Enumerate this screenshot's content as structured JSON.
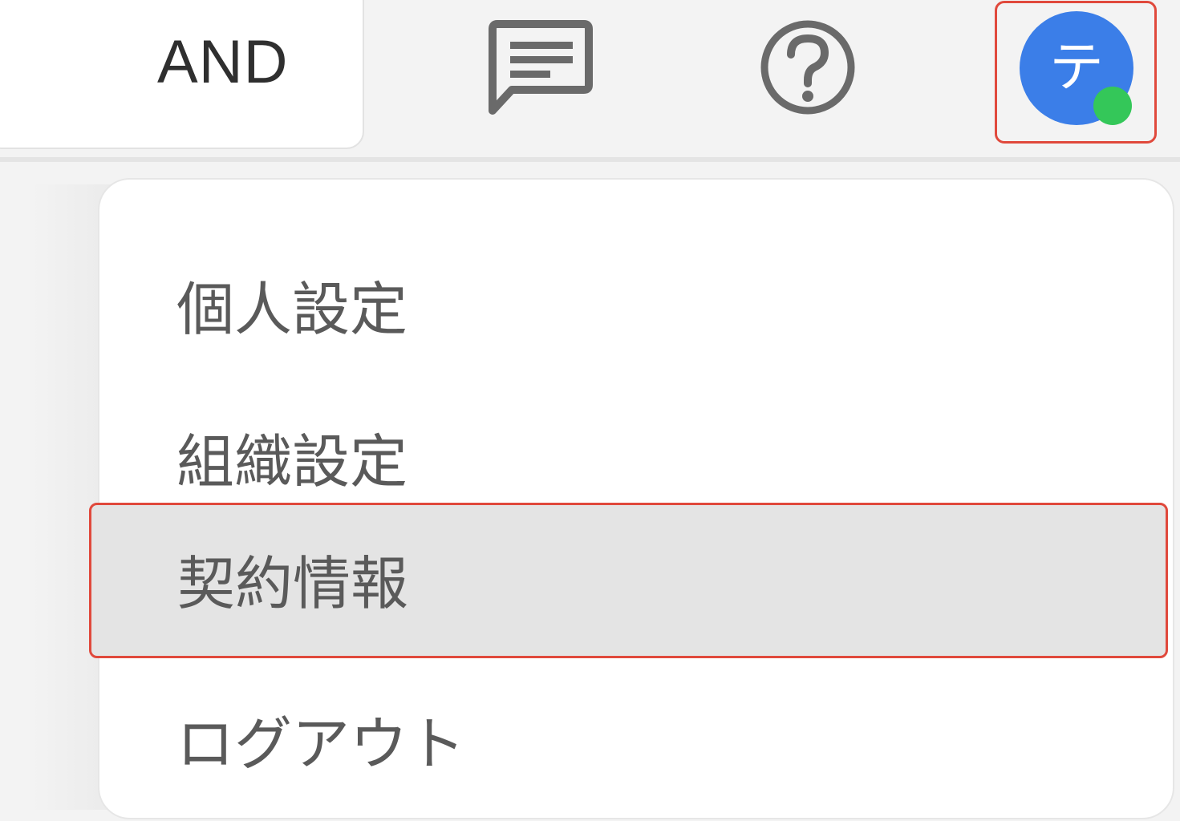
{
  "header": {
    "search_mode_label": "AND",
    "chat_icon": "chat-bubble-icon",
    "help_icon": "help-circle-icon",
    "avatar_initial": "テ",
    "avatar_color": "#3b7ee8",
    "presence_color": "#34c759",
    "highlight_color": "#e0493c"
  },
  "user_menu": {
    "items": [
      {
        "label": "個人設定"
      },
      {
        "label": "組織設定"
      },
      {
        "label": "契約情報"
      },
      {
        "label": "ログアウト"
      }
    ],
    "hovered_index": 2
  }
}
